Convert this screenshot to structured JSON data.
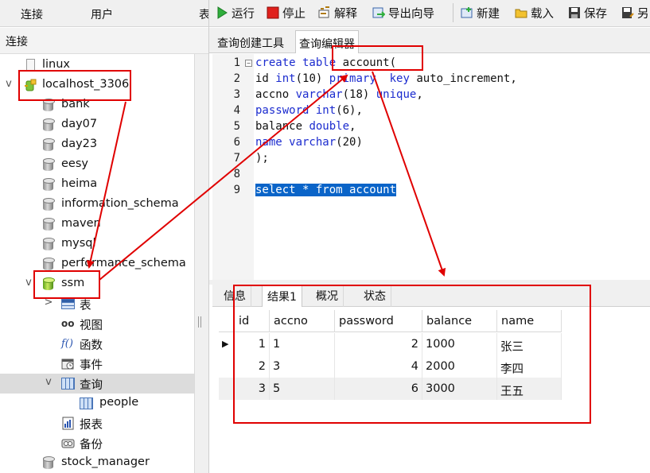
{
  "left_topbar": {
    "tabs": [
      "连接",
      "用户",
      "表"
    ]
  },
  "connection_header": "连接",
  "tree": [
    {
      "label": "linux",
      "icon": "file-icon",
      "level": 1,
      "arrow": ""
    },
    {
      "label": "localhost_3306",
      "icon": "connection-icon",
      "level": 0,
      "arrow": "v"
    },
    {
      "label": "bank",
      "icon": "database-icon",
      "level": 1,
      "arrow": ""
    },
    {
      "label": "day07",
      "icon": "database-icon",
      "level": 1,
      "arrow": ""
    },
    {
      "label": "day23",
      "icon": "database-icon",
      "level": 1,
      "arrow": ""
    },
    {
      "label": "eesy",
      "icon": "database-icon",
      "level": 1,
      "arrow": ""
    },
    {
      "label": "heima",
      "icon": "database-icon",
      "level": 1,
      "arrow": ""
    },
    {
      "label": "information_schema",
      "icon": "database-icon",
      "level": 1,
      "arrow": ""
    },
    {
      "label": "maven",
      "icon": "database-icon",
      "level": 1,
      "arrow": ""
    },
    {
      "label": "mysql",
      "icon": "database-icon",
      "level": 1,
      "arrow": ""
    },
    {
      "label": "performance_schema",
      "icon": "database-icon",
      "level": 1,
      "arrow": ""
    },
    {
      "label": "ssm",
      "icon": "database-open-icon",
      "level": 1,
      "arrow": "v"
    },
    {
      "label": "表",
      "icon": "table-icon",
      "level": 2,
      "arrow": ">"
    },
    {
      "label": "视图",
      "icon": "view-icon",
      "level": 2,
      "arrow": ""
    },
    {
      "label": "函数",
      "icon": "function-icon",
      "level": 2,
      "arrow": ""
    },
    {
      "label": "事件",
      "icon": "event-icon",
      "level": 2,
      "arrow": ""
    },
    {
      "label": "查询",
      "icon": "query-icon",
      "level": 2,
      "arrow": "v"
    },
    {
      "label": "people",
      "icon": "query-item-icon",
      "level": 3,
      "arrow": ""
    },
    {
      "label": "报表",
      "icon": "report-icon",
      "level": 2,
      "arrow": ""
    },
    {
      "label": "备份",
      "icon": "backup-icon",
      "level": 2,
      "arrow": ""
    },
    {
      "label": "stock_manager",
      "icon": "database-icon",
      "level": 1,
      "arrow": ""
    }
  ],
  "toolbar": {
    "run": "运行",
    "stop": "停止",
    "explain": "解释",
    "export_wizard": "导出向导",
    "new": "新建",
    "load": "载入",
    "save": "保存",
    "save_as": "另"
  },
  "editor_tabs": [
    "查询创建工具",
    "查询编辑器"
  ],
  "editor": {
    "line_numbers": [
      "1",
      "2",
      "3",
      "4",
      "5",
      "6",
      "7",
      "8",
      "9"
    ],
    "fold_marker": "−",
    "lines": [
      "create table account(",
      "id int(10) primary  key auto_increment,",
      "accno varchar(18) unique,",
      "password int(6),",
      "balance double,",
      "name varchar(20)",
      ");",
      "",
      "select * from account"
    ]
  },
  "result_tabs": [
    "信息",
    "结果1",
    "概况",
    "状态"
  ],
  "grid": {
    "columns": [
      "id",
      "accno",
      "password",
      "balance",
      "name"
    ],
    "current_row_marker": "▶",
    "rows": [
      [
        "1",
        "1",
        "2",
        "1000",
        "张三"
      ],
      [
        "2",
        "3",
        "4",
        "2000",
        "李四"
      ],
      [
        "3",
        "5",
        "6",
        "3000",
        "王五"
      ]
    ]
  },
  "colors": {
    "annotation_red": "#e00000",
    "keyword_blue": "#1c2ccf",
    "selection_blue": "#0a64c8"
  }
}
